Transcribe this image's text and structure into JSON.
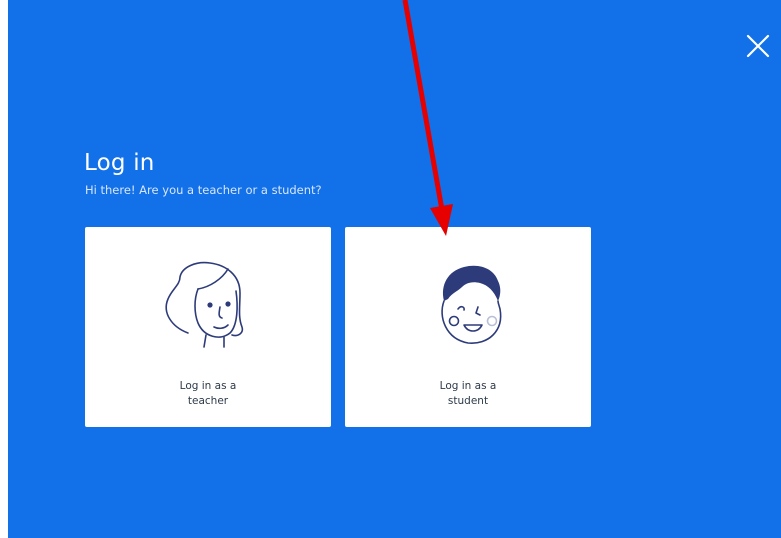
{
  "login": {
    "title": "Log in",
    "subtitle": "Hi there! Are you a teacher or a student?",
    "options": [
      {
        "role": "teacher",
        "label": "Log in as a\nteacher",
        "icon": "teacher-face-icon"
      },
      {
        "role": "student",
        "label": "Log in as a\nstudent",
        "icon": "student-face-icon"
      }
    ],
    "close_icon": "close-icon"
  },
  "annotation": {
    "arrow_color": "#e60000"
  },
  "colors": {
    "modal_background": "#1270e8",
    "card_background": "#ffffff",
    "illustration_stroke": "#2d3b7a"
  }
}
